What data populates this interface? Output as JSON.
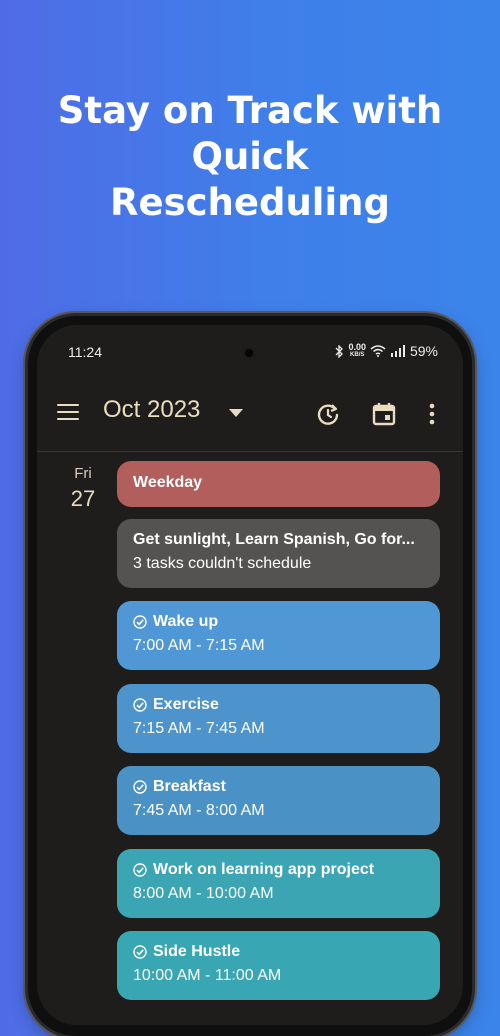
{
  "headline": [
    "Stay on Track with",
    "Quick",
    "Rescheduling"
  ],
  "status_bar": {
    "time": "11:24",
    "net_speed": "0.00",
    "net_unit": "KB/S",
    "battery": "59%"
  },
  "app_bar": {
    "month": "Oct 2023"
  },
  "day": {
    "name": "Fri",
    "number": "27"
  },
  "events": [
    {
      "title": "Weekday",
      "subtitle": "",
      "color": "#b15e5c",
      "checked": false
    },
    {
      "title": "Get sunlight, Learn Spanish, Go for...",
      "subtitle": "3 tasks couldn't schedule",
      "color": "#555352",
      "checked": false
    },
    {
      "title": "Wake up",
      "subtitle": "7:00 AM - 7:15 AM",
      "color": "#4f97d5",
      "checked": true
    },
    {
      "title": "Exercise",
      "subtitle": "7:15 AM - 7:45 AM",
      "color": "#4c94cb",
      "checked": true
    },
    {
      "title": "Breakfast",
      "subtitle": "7:45 AM - 8:00 AM",
      "color": "#4a92c6",
      "checked": true
    },
    {
      "title": "Work on learning app project",
      "subtitle": "8:00 AM - 10:00 AM",
      "color": "#3ba5b4",
      "checked": true
    },
    {
      "title": "Side Hustle",
      "subtitle": "10:00 AM - 11:00 AM",
      "color": "#39a6b3",
      "checked": true
    }
  ]
}
